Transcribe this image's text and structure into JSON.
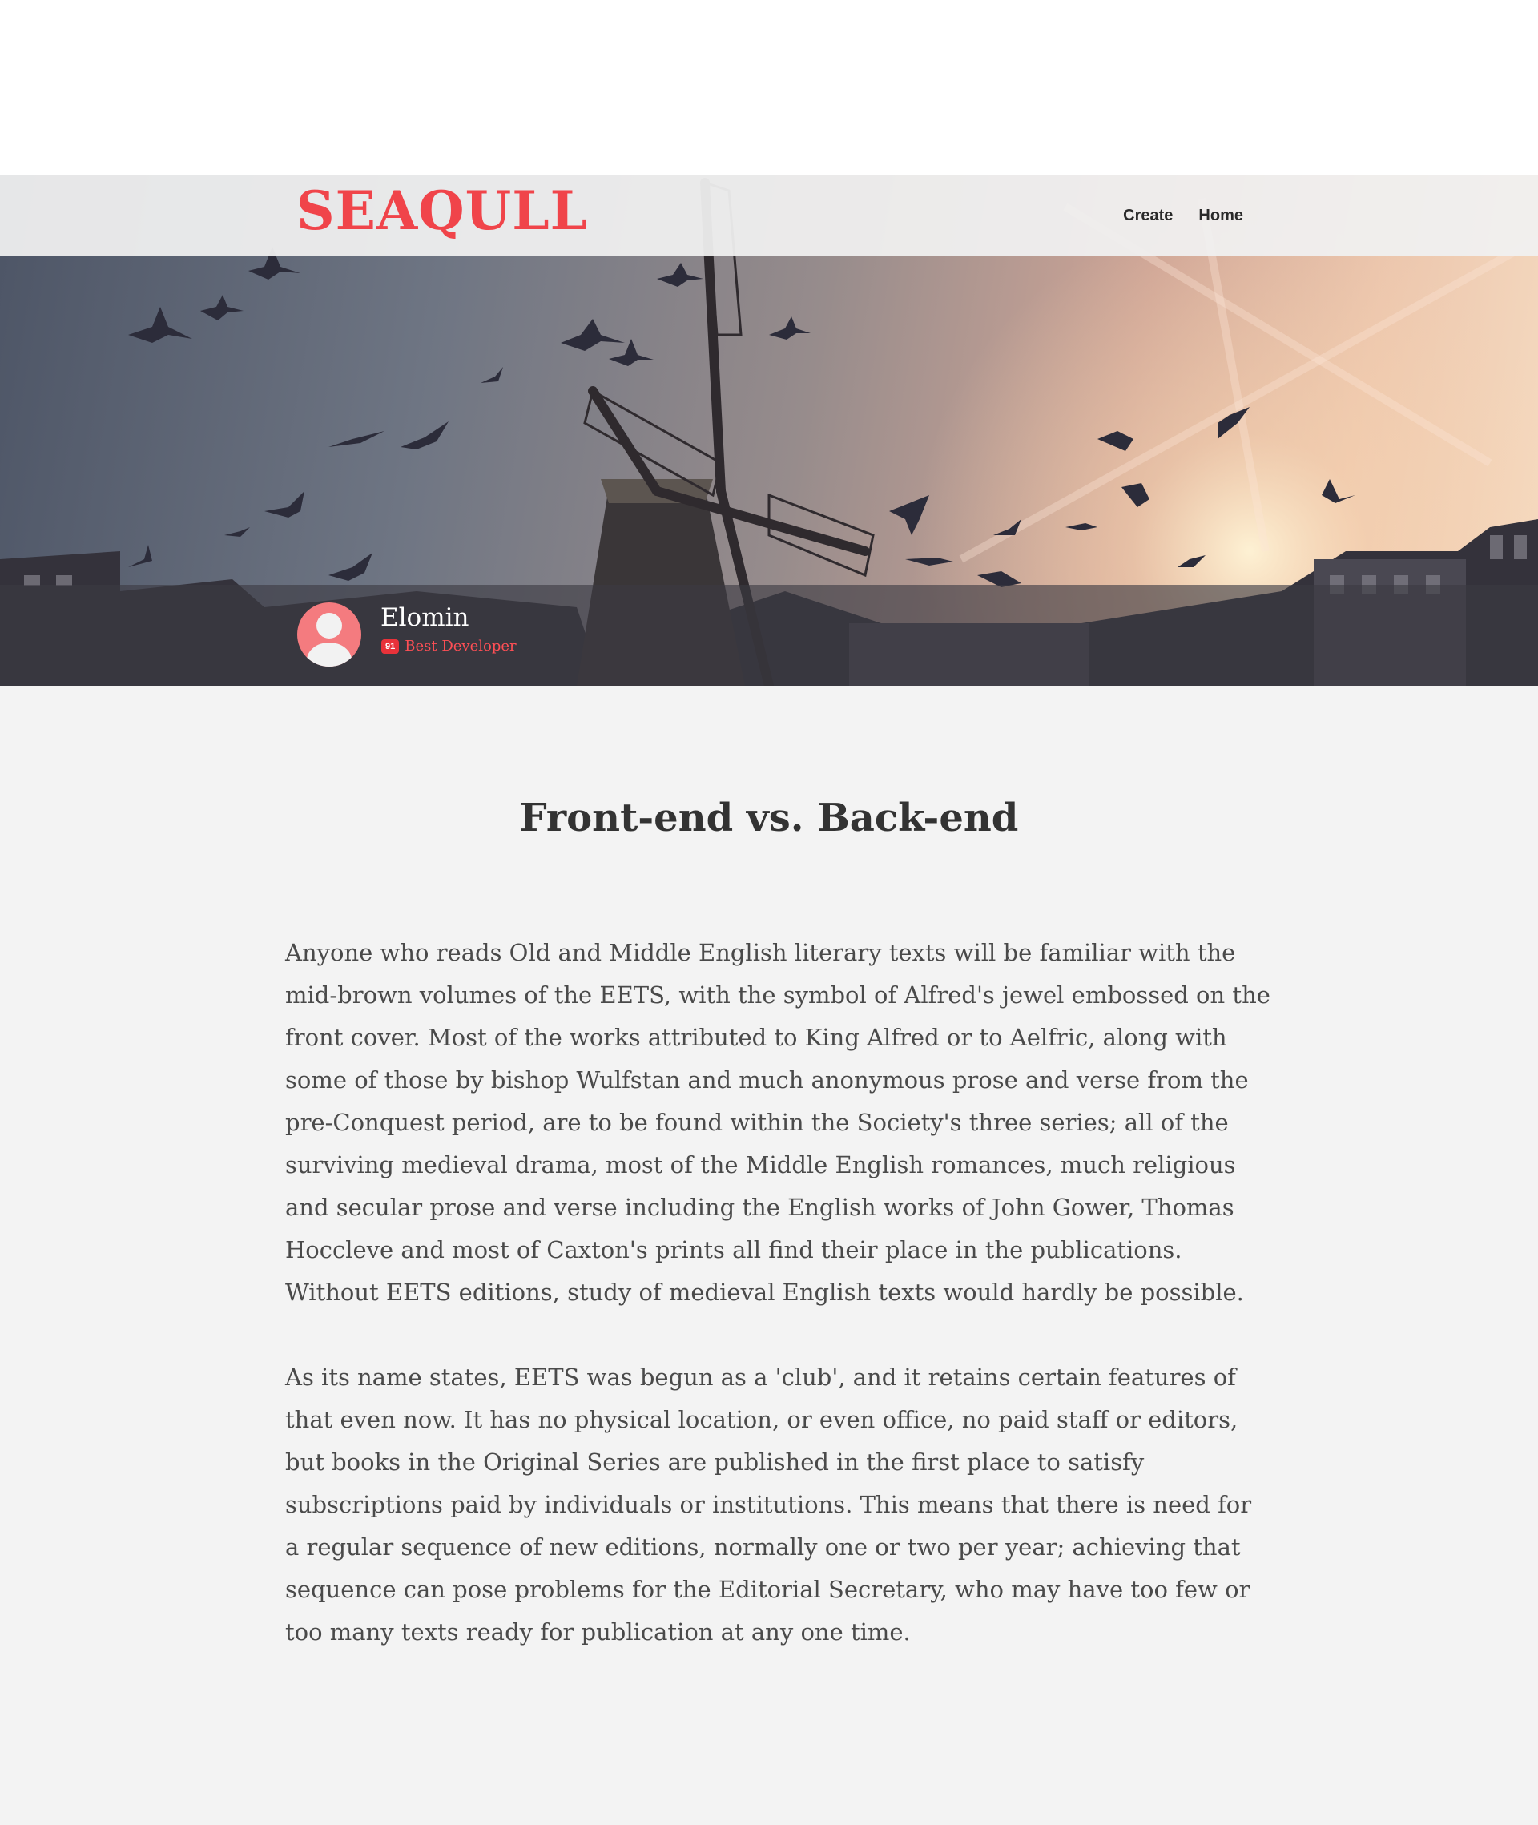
{
  "site": {
    "logo": "SEAQULL"
  },
  "nav": {
    "links": [
      {
        "label": "Create"
      },
      {
        "label": "Home"
      }
    ]
  },
  "profile": {
    "name": "Elomin",
    "badge_count": "91",
    "badge_label": "Best Developer"
  },
  "post": {
    "title": "Front-end vs. Back-end",
    "paragraphs": [
      "Anyone who reads Old and Middle English literary texts will be familiar with the mid-brown volumes of the EETS, with the symbol of Alfred's jewel em­bossed on the front cover. Most of the works attributed to King Alfred or to Aelfric, along with some of those by bishop Wulfstan and much anonymous prose and verse from the pre-Conquest period, are to be found within the Soci­ety's three series; all of the surviving medieval drama, most of the Middle En­glish romances, much religious and secular prose and verse including the En­glish works of John Gower, Thomas Hoccleve and most of Caxton's prints all find their place in the publications. Without EETS editions, study of medieval English texts would hardly be possible.",
      "As its name states, EETS was begun as a 'club', and it retains certain features of that even now. It has no physical location, or even office, no paid staff or edi­tors, but books in the Original Series are published in the first place to satisfy subscriptions paid by individuals or institutions. This means that there is need for a regular sequence of new editions, normally one or two per year; achieving that sequence can pose problems for the Editorial Secretary, who may have too few or too many texts ready for publication at any one time."
    ]
  },
  "colors": {
    "accent": "#f0444a",
    "page_background": "#f3f3f3",
    "text": "#4a4a4a"
  }
}
